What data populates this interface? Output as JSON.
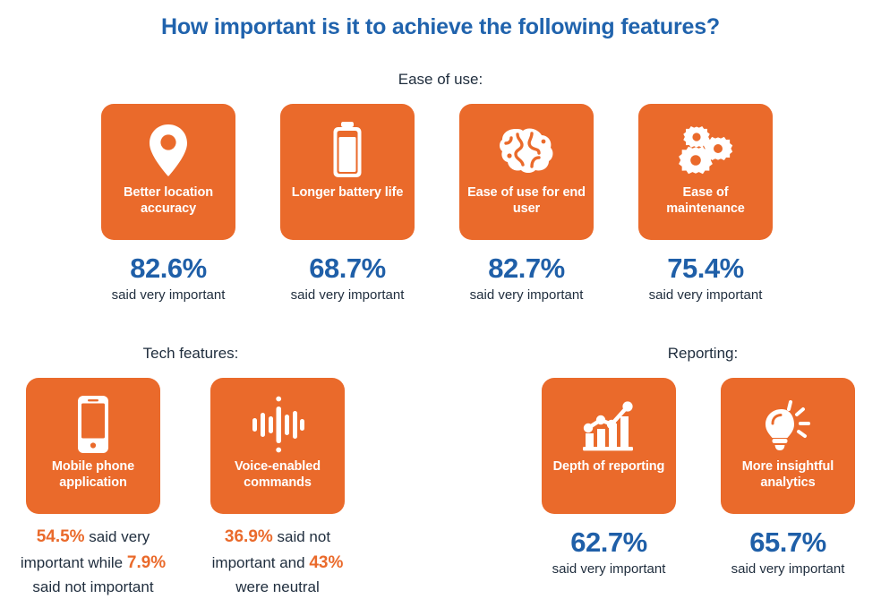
{
  "title": "How important is it to achieve the following features?",
  "sections": {
    "ease_of_use": "Ease of use:",
    "tech_features": "Tech features:",
    "reporting": "Reporting:"
  },
  "colors": {
    "orange": "#ea6a2b",
    "blue": "#1f5fa8",
    "title_blue": "#2063ad",
    "dark_text": "#1f2d3d",
    "card_text": "#ffffff"
  },
  "cards": {
    "location": {
      "label": "Better location accuracy",
      "icon": "map-pin-icon",
      "percent": "82.6%",
      "caption": "said very important"
    },
    "battery": {
      "label": "Longer battery life",
      "icon": "battery-icon",
      "percent": "68.7%",
      "caption": "said very important"
    },
    "easeuse": {
      "label": "Ease of use for end user",
      "icon": "brain-icon",
      "percent": "82.7%",
      "caption": "said very important"
    },
    "maintenance": {
      "label": "Ease of maintenance",
      "icon": "gears-icon",
      "percent": "75.4%",
      "caption": "said very important"
    },
    "mobile": {
      "label": "Mobile phone application",
      "icon": "mobile-phone-icon",
      "percent_very_important": "54.5%",
      "text_1": " said very important while ",
      "percent_not_important": "7.9%",
      "text_2": " said not important"
    },
    "voice": {
      "label": "Voice-enabled commands",
      "icon": "voice-waveform-icon",
      "percent_not_important": "36.9%",
      "text_1": " said not important and ",
      "percent_neutral": "43%",
      "text_2": " were neutral"
    },
    "depth": {
      "label": "Depth of reporting",
      "icon": "bar-chart-trend-icon",
      "percent": "62.7%",
      "caption": "said very important"
    },
    "insight": {
      "label": "More insightful analytics",
      "icon": "lightbulb-icon",
      "percent": "65.7%",
      "caption": "said very important"
    }
  }
}
